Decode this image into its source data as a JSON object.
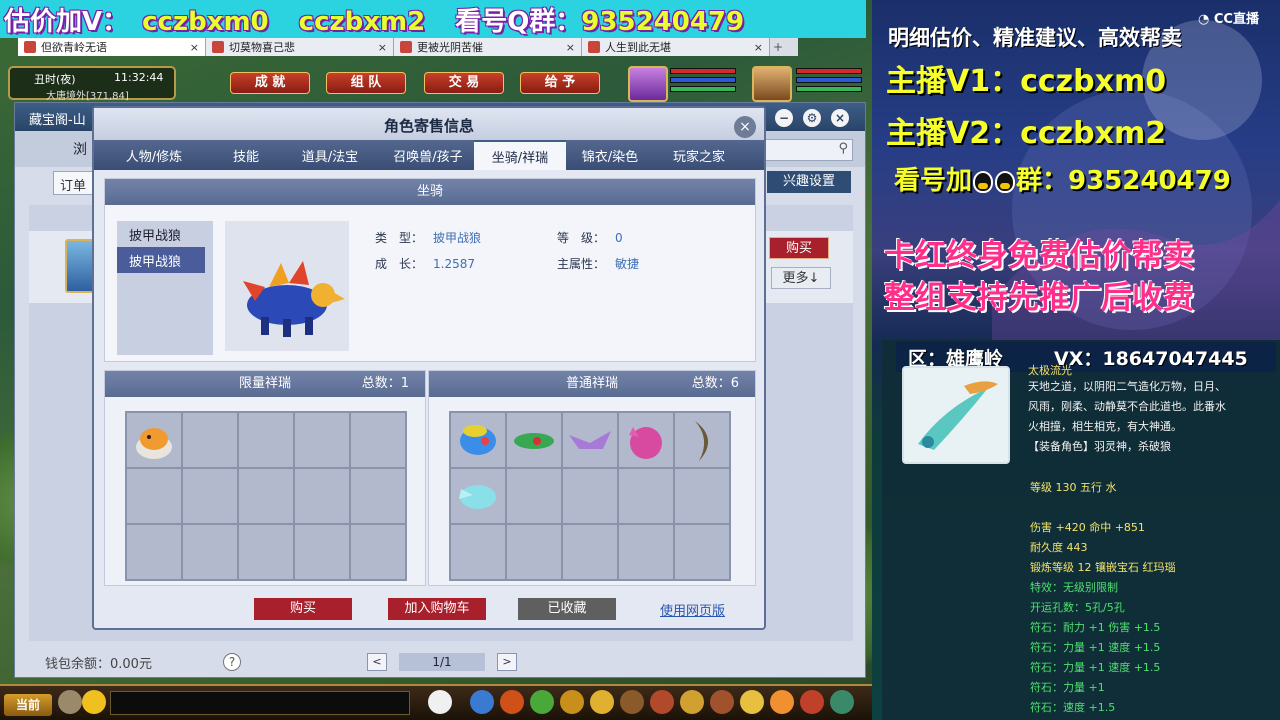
{
  "top_banner": {
    "part1": "估价加V：",
    "v1": "cczbxm0",
    "v2": "cczbxm2",
    "part2": "看号Q群：",
    "qq_group": "935240479"
  },
  "browser_tabs": [
    {
      "label": "但欲青岭无语",
      "close": "×"
    },
    {
      "label": "切莫物喜己悲",
      "close": "×"
    },
    {
      "label": "更被光阴苦催",
      "close": "×"
    },
    {
      "label": "人生到此无堪",
      "close": "×"
    }
  ],
  "browser_tab_plus": "+",
  "hud": {
    "time_label": "丑时(夜)",
    "clock": "11:32:44",
    "location": "大唐境外[371,84]"
  },
  "game_buttons": [
    "成 就",
    "组 队",
    "交 易",
    "给 予"
  ],
  "store": {
    "title": "藏宝阁-山",
    "browse_label": "浏",
    "order_label": "订单",
    "interest_button": "兴趣设置",
    "buy_button": "购买",
    "more_button": "更多↓",
    "wallet": "钱包余额：0.00元",
    "help": "?",
    "prev": "<",
    "next": ">",
    "page": "1/1"
  },
  "modal": {
    "title": "角色寄售信息",
    "close": "×",
    "tabs": [
      "人物/修炼",
      "技能",
      "道具/法宝",
      "召唤兽/孩子",
      "坐骑/祥瑞",
      "锦衣/染色",
      "玩家之家"
    ],
    "active_tab": 4,
    "mount_header": "坐骑",
    "mount_list": [
      "披甲战狼",
      "披甲战狼"
    ],
    "mount_info": {
      "type_label": "类　型：",
      "type_value": "披甲战狼",
      "level_label": "等　级：",
      "level_value": "0",
      "growth_label": "成　长：",
      "growth_value": "1.2587",
      "attr_label": "主属性：",
      "attr_value": "敏捷"
    },
    "limited": {
      "title": "限量祥瑞",
      "count": "总数：1"
    },
    "normal": {
      "title": "普通祥瑞",
      "count": "总数：6"
    },
    "buttons": {
      "buy": "购买",
      "cart": "加入购物车",
      "saved": "已收藏",
      "web": "使用网页版"
    }
  },
  "gamebar": {
    "current": "当前"
  },
  "right_panel": {
    "line1": "明细估价、精准建议、高效帮卖",
    "line2": "主播V1：cczbxm0",
    "line3": "主播V2：cczbxm2",
    "line4a": "看号加",
    "line4b": "群：935240479",
    "line5": "卡红终身免费估价帮卖",
    "line6": "整组支持先推广后收费",
    "cc_logo": "CC直播",
    "region": "区：雄鹰岭",
    "vx": "VX：18647047445"
  },
  "tooltip": {
    "name": "太极流光",
    "desc1": "天地之道，以阴阳二气造化万物，日月、",
    "desc2": "风雨，刚柔、动静莫不合此道也。此番水",
    "desc3": "火相撞，相生相克，有大神通。",
    "equip_role": "【装备角色】羽灵神，杀破狼",
    "level_line": "等级 130 五行 水",
    "dmg": "伤害 +420 命中 +851",
    "durability": "耐久度 443",
    "forge": "锻炼等级 12 镶嵌宝石 红玛瑙",
    "special": "特效：无级别限制",
    "holes": "开运孔数：5孔/5孔",
    "rune1": "符石：耐力 +1 伤害 +1.5",
    "rune2": "符石：力量 +1 速度 +1.5",
    "rune3": "符石：力量 +1 速度 +1.5",
    "rune4": "符石：力量 +1",
    "rune5": "符石：速度 +1.5"
  },
  "colors": {
    "accent_blue": "#3d5e86",
    "buy_red": "#a7202c",
    "banner_yellow": "#f7ff2a",
    "promo_pink": "#ff2e8a"
  }
}
